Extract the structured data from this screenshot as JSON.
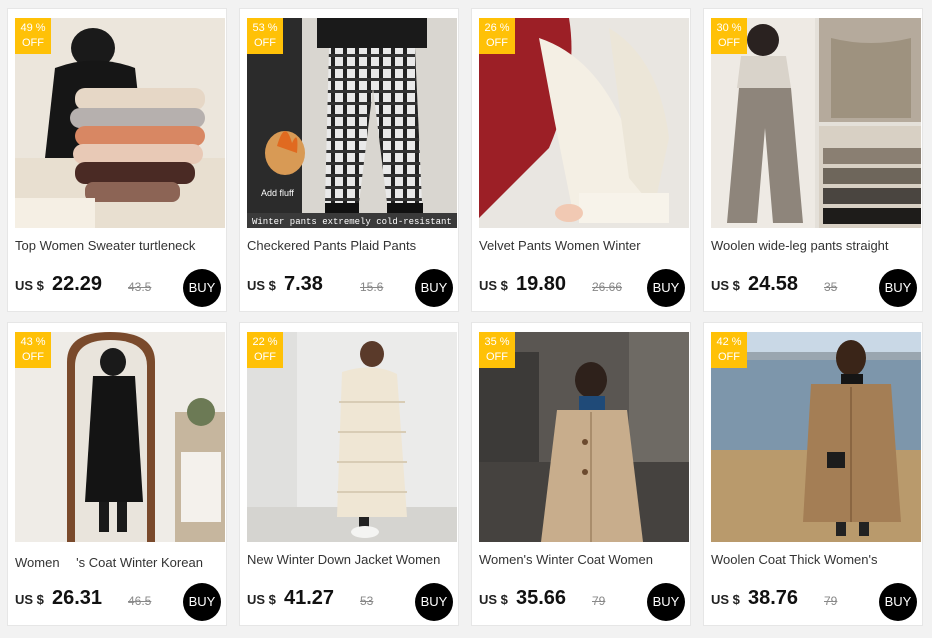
{
  "currency": "US $",
  "buy_label": "BUY",
  "badge_suffix": "OFF",
  "products": [
    {
      "discount": "49 %",
      "title": "Top Women Sweater turtleneck",
      "price": "22.29",
      "old_price": "43.5"
    },
    {
      "discount": "53 %",
      "title": "Checkered Pants Plaid Pants",
      "price": "7.38",
      "old_price": "15.6",
      "image_overlay": "Winter pants extremely cold-resistant",
      "image_tag": "Add fluff"
    },
    {
      "discount": "26 %",
      "title": "Velvet Pants Women Winter",
      "price": "19.80",
      "old_price": "26.66"
    },
    {
      "discount": "30 %",
      "title": "Woolen wide-leg pants straight",
      "price": "24.58",
      "old_price": "35"
    },
    {
      "discount": "43 %",
      "title": "Women 　's Coat Winter Korean",
      "price": "26.31",
      "old_price": "46.5"
    },
    {
      "discount": "22 %",
      "title": "New Winter Down Jacket Women",
      "price": "41.27",
      "old_price": "53"
    },
    {
      "discount": "35 %",
      "title": "Women's Winter Coat Women",
      "price": "35.66",
      "old_price": "79"
    },
    {
      "discount": "42 %",
      "title": "Woolen Coat Thick Women's",
      "price": "38.76",
      "old_price": "79"
    }
  ]
}
